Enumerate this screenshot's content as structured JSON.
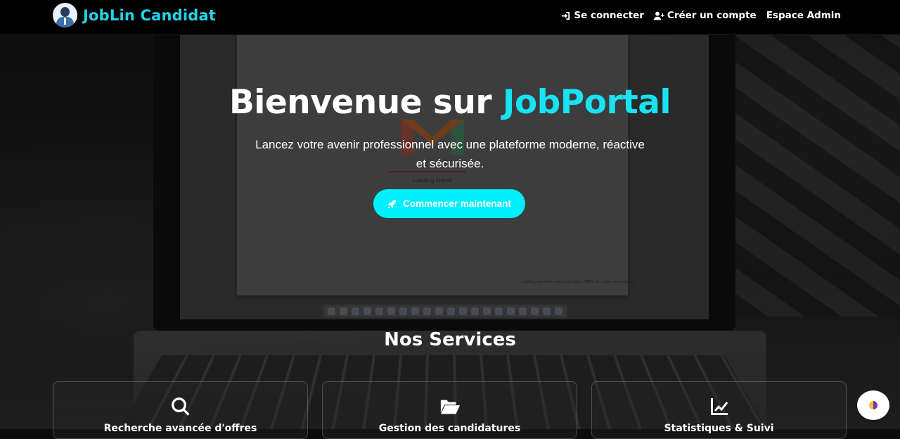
{
  "navbar": {
    "brand": "JobLin Candidat",
    "links": [
      {
        "label": "Se connecter",
        "icon": "sign-in-icon"
      },
      {
        "label": "Créer un compte",
        "icon": "user-plus-icon"
      },
      {
        "label": "Espace Admin",
        "icon": ""
      }
    ]
  },
  "hero": {
    "title_prefix": "Bienvenue sur ",
    "title_accent": "JobPortal",
    "subtitle": "Lancez votre avenir professionnel avec une plateforme moderne, réactive et sécurisée.",
    "cta_label": "Commencer maintenant",
    "cta_icon": "rocket-icon"
  },
  "background": {
    "gmail_loading": "Loading Gmail",
    "gmail_footer": "Loading standard view (Load basic HTML (for slow connections))"
  },
  "services": {
    "title": "Nos Services",
    "cards": [
      {
        "icon": "search-icon",
        "label": "Recherche avancée d'offres"
      },
      {
        "icon": "folder-open-icon",
        "label": "Gestion des candidatures"
      },
      {
        "icon": "chart-line-icon",
        "label": "Statistiques & Suivi"
      }
    ]
  },
  "colors": {
    "accent": "#17e3f2",
    "cta": "#00f0ff",
    "navbar": "#000000"
  }
}
